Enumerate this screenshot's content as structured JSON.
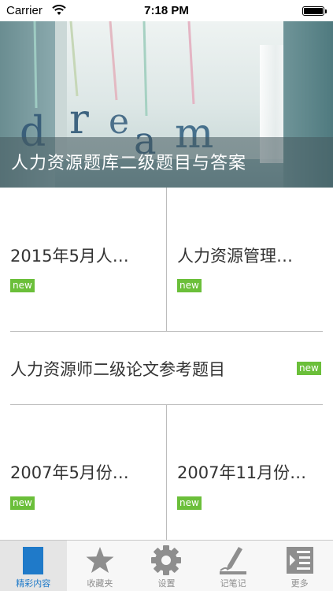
{
  "status_bar": {
    "carrier": "Carrier",
    "time": "7:18 PM",
    "battery_level": 1.0
  },
  "hero": {
    "caption": "人力资源题库二级题目与答案",
    "decor_letters": [
      "d",
      "r",
      "e",
      "a",
      "m"
    ]
  },
  "grid": {
    "items": [
      {
        "title": "2015年5月人…",
        "badge": "new"
      },
      {
        "title": "人力资源管理…",
        "badge": "new"
      },
      {
        "title": "人力资源师二级论文参考题目",
        "badge": "new"
      },
      {
        "title": "2007年5月份…",
        "badge": "new"
      },
      {
        "title": "2007年11月份…",
        "badge": "new"
      }
    ]
  },
  "tab_bar": {
    "tabs": [
      {
        "label": "精彩内容",
        "icon": "document-icon",
        "active": true
      },
      {
        "label": "收藏夹",
        "icon": "star-icon",
        "active": false
      },
      {
        "label": "设置",
        "icon": "gear-icon",
        "active": false
      },
      {
        "label": "记笔记",
        "icon": "pen-icon",
        "active": false
      },
      {
        "label": "更多",
        "icon": "list-icon",
        "active": false
      }
    ]
  },
  "colors": {
    "badge": "#6bbf3a",
    "active_tab": "#1f7ac9",
    "inactive_tab": "#8e8e8e"
  }
}
